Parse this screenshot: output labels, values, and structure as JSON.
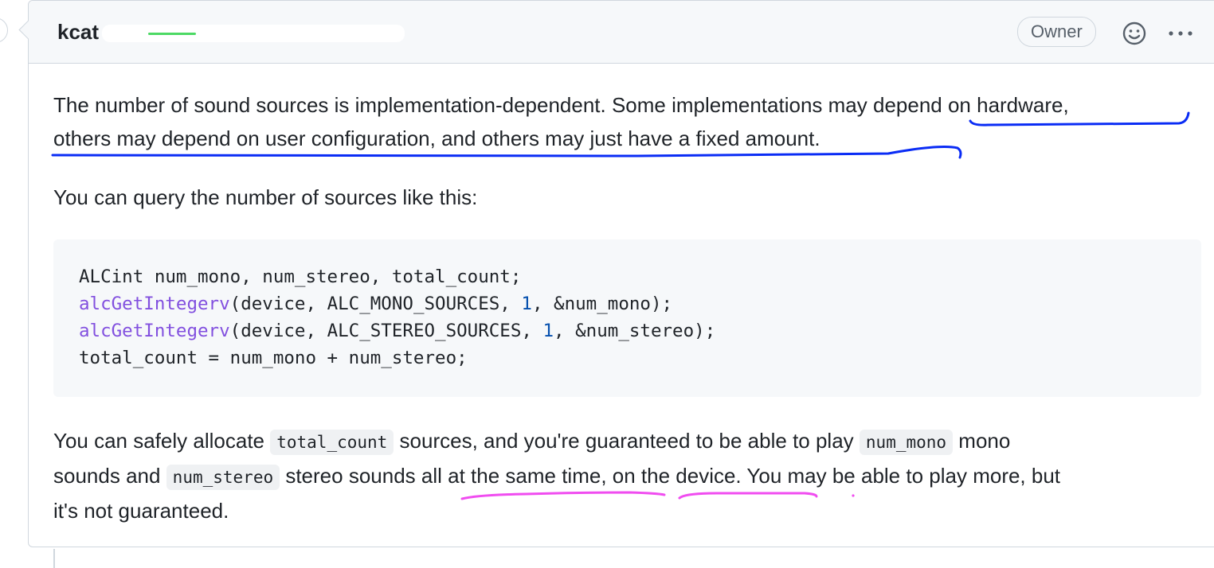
{
  "header": {
    "author": "kcat",
    "owner_badge": "Owner",
    "reaction_icon": "smiley-icon",
    "menu_icon": "kebab-icon"
  },
  "body": {
    "paragraph1_a": "The number of sound sources is implementation-dependent. Some implementations may depend on hardware,",
    "paragraph1_b": "others may depend on user configuration, and others may just have a fixed amount.",
    "paragraph2": "You can query the number of sources like this:",
    "code": {
      "line1": "ALCint num_mono, num_stereo, total_count;",
      "line2_fn": "alcGetIntegerv",
      "line2_a": "(device, ALC_MONO_SOURCES, ",
      "line2_num": "1",
      "line2_b": ", &num_mono);",
      "line3_fn": "alcGetIntegerv",
      "line3_a": "(device, ALC_STEREO_SOURCES, ",
      "line3_num": "1",
      "line3_b": ", &num_stereo);",
      "line4": "total_count = num_mono + num_stereo;"
    },
    "paragraph3": {
      "t1": "You can safely allocate ",
      "code1": "total_count",
      "t2": " sources, and you're guaranteed to be able to play ",
      "code2": "num_mono",
      "t3": " mono",
      "t4": "sounds and ",
      "code3": "num_stereo",
      "t5": " stereo sounds all at the same time, on the device. You may be able to play more, but",
      "t6": "it's not guaranteed."
    }
  },
  "colors": {
    "annotation_blue": "#0a2cf5",
    "annotation_pink": "#f04cf0",
    "code_function": "#8250df",
    "code_number": "#0550ae"
  }
}
